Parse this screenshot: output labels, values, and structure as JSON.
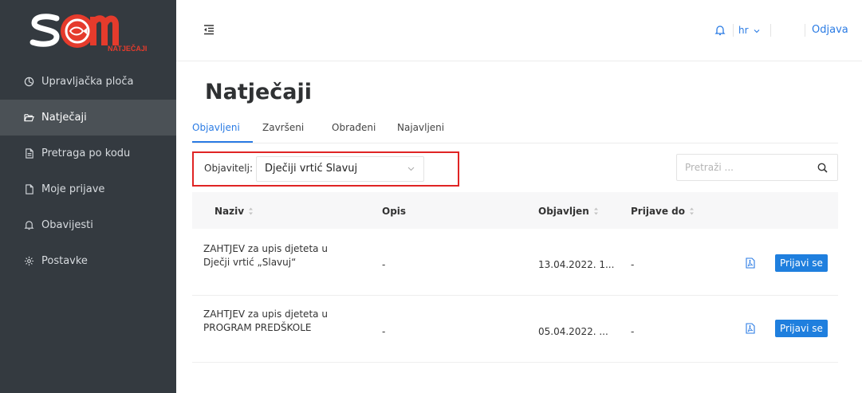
{
  "logo": {
    "text": "NATJEČAJI"
  },
  "sidebar": {
    "items": [
      {
        "label": "Upravljačka ploča",
        "icon": "dashboard-icon"
      },
      {
        "label": "Natječaji",
        "icon": "folder-open-icon"
      },
      {
        "label": "Pretraga po kodu",
        "icon": "document-icon"
      },
      {
        "label": "Moje prijave",
        "icon": "file-icon"
      },
      {
        "label": "Obavijesti",
        "icon": "bell-icon"
      },
      {
        "label": "Postavke",
        "icon": "gear-icon"
      }
    ]
  },
  "topbar": {
    "language": "hr",
    "logout": "Odjava"
  },
  "page": {
    "title": "Natječaji"
  },
  "tabs": [
    {
      "label": "Objavljeni"
    },
    {
      "label": "Završeni"
    },
    {
      "label": "Obrađeni"
    },
    {
      "label": "Najavljeni"
    }
  ],
  "filter": {
    "label": "Objavitelj:",
    "value": "Dječiji vrtić Slavuj"
  },
  "search": {
    "placeholder": "Pretraži ..."
  },
  "table": {
    "columns": {
      "name": "Naziv",
      "description": "Opis",
      "published": "Objavljen",
      "deadline": "Prijave do"
    },
    "rows": [
      {
        "name_line1": "ZAHTJEV za upis djeteta u",
        "name_line2": "Dječji vrtić „Slavuj“",
        "description": "-",
        "published": "13.04.2022. 1...",
        "deadline": "-",
        "action": "Prijavi se"
      },
      {
        "name_line1": "ZAHTJEV za upis djeteta u",
        "name_line2": "PROGRAM PREDŠKOLE",
        "description": "-",
        "published": "05.04.2022. ...",
        "deadline": "-",
        "action": "Prijavi se"
      }
    ]
  },
  "colors": {
    "sidebar": "#343a40",
    "accent": "#2a7be4",
    "brand_red": "#e53b2c",
    "highlight": "#e02424"
  }
}
